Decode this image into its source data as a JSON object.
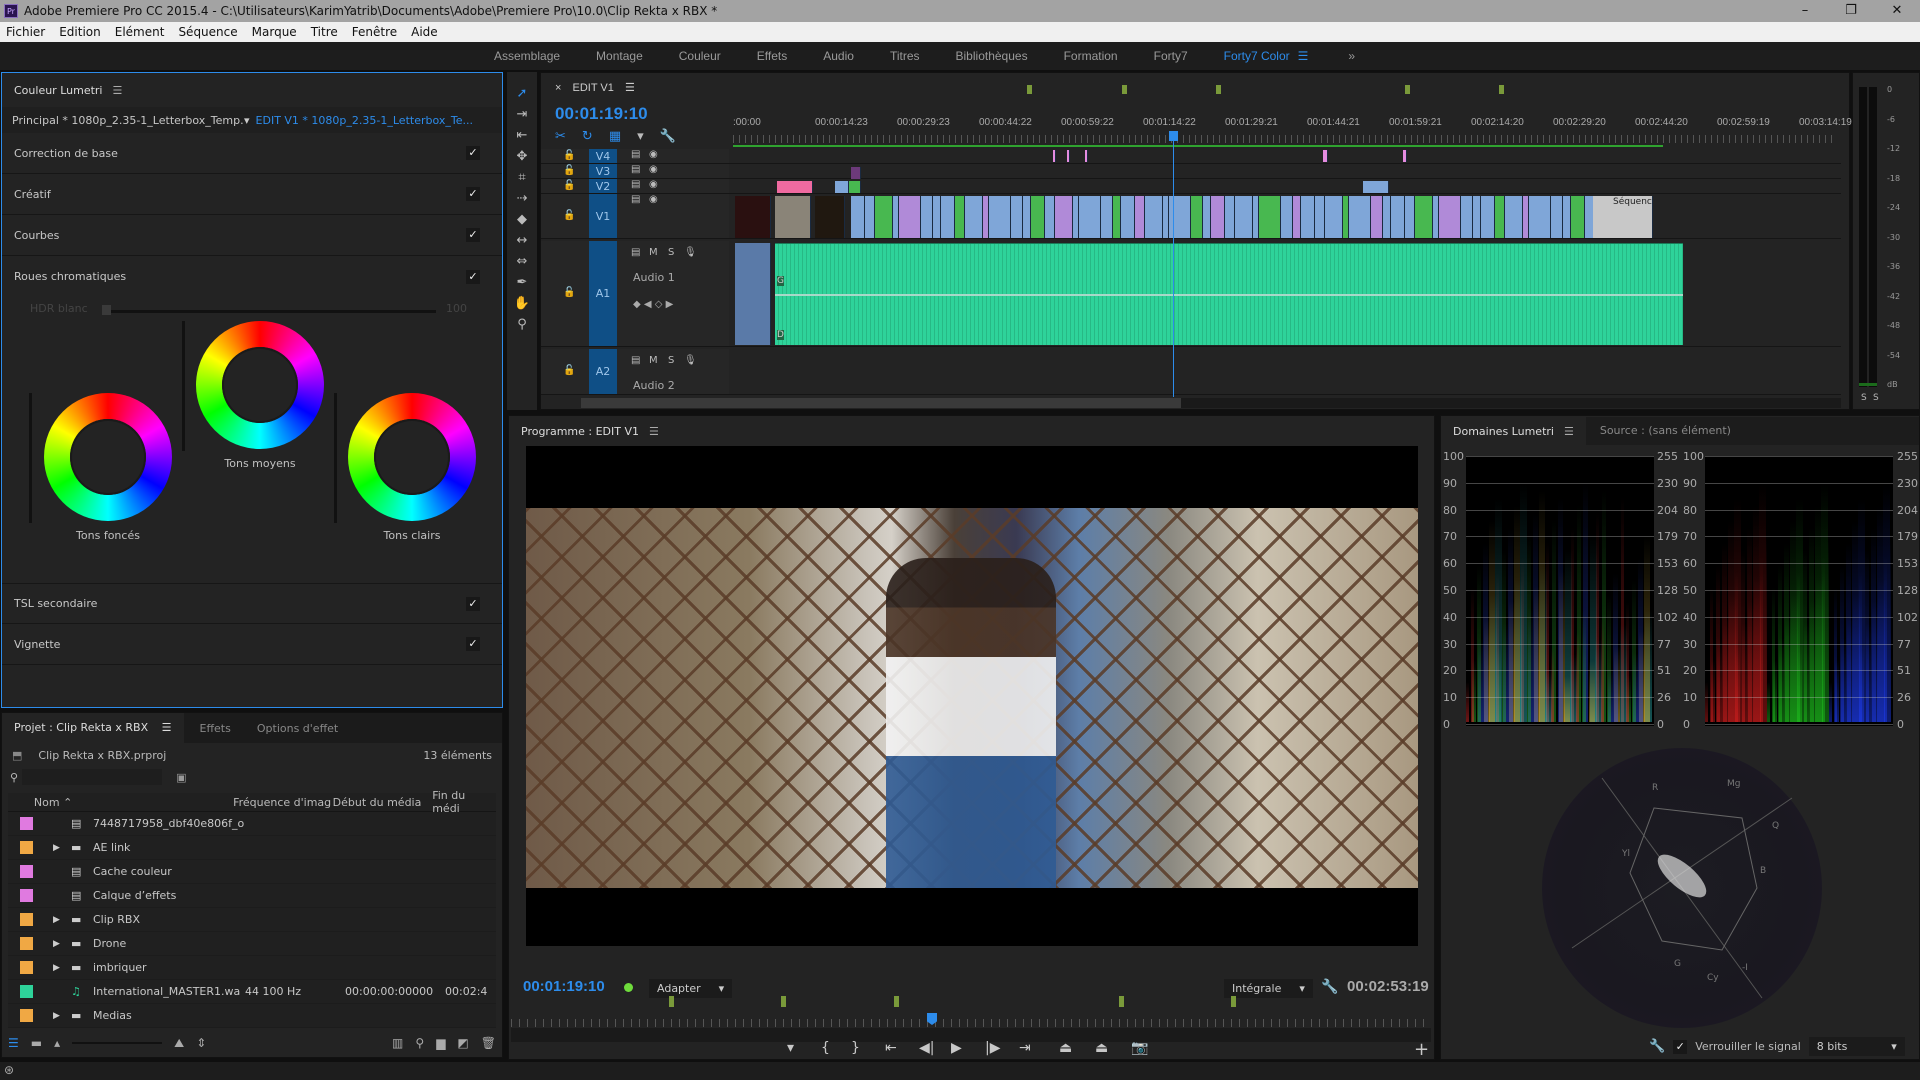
{
  "window": {
    "title": "Adobe Premiere Pro CC 2015.4 - C:\\Utilisateurs\\KarimYatrib\\Documents\\Adobe\\Premiere Pro\\10.0\\Clip Rekta x RBX *",
    "app_icon": "Pr",
    "controls": [
      "–",
      "❐",
      "✕"
    ]
  },
  "menu": [
    "Fichier",
    "Edition",
    "Elément",
    "Séquence",
    "Marque",
    "Titre",
    "Fenêtre",
    "Aide"
  ],
  "workspaces": {
    "items": [
      "Assemblage",
      "Montage",
      "Couleur",
      "Effets",
      "Audio",
      "Titres",
      "Bibliothèques",
      "Formation",
      "Forty7",
      "Forty7 Color"
    ],
    "active": "Forty7 Color",
    "more": "»"
  },
  "lumetri": {
    "title": "Couleur Lumetri",
    "source_master": "Principal * 1080p_2.35-1_Letterbox_Temp...",
    "source_clip": "EDIT V1 * 1080p_2.35-1_Letterbox_Te...",
    "sections": [
      {
        "label": "Correction de base",
        "enabled": true
      },
      {
        "label": "Créatif",
        "enabled": true
      },
      {
        "label": "Courbes",
        "enabled": true
      },
      {
        "label": "Roues chromatiques",
        "enabled": true
      }
    ],
    "hdr_label": "HDR blanc",
    "hdr_value": "100",
    "wheels": {
      "shadows": "Tons foncés",
      "midtones": "Tons moyens",
      "highlights": "Tons clairs"
    },
    "bottom_sections": [
      {
        "label": "TSL secondaire",
        "enabled": true
      },
      {
        "label": "Vignette",
        "enabled": true
      }
    ]
  },
  "project": {
    "tabs": [
      "Projet : Clip Rekta x RBX",
      "Effets",
      "Options d'effet"
    ],
    "file": "Clip Rekta x RBX.prproj",
    "count": "13 éléments",
    "search_placeholder": "",
    "columns": [
      "Nom",
      "Fréquence d'imag",
      "Début du média",
      "Fin du médi"
    ],
    "rows": [
      {
        "color": "#e07ae0",
        "type": "file",
        "name": "7448717958_dbf40e806f_o",
        "fps": "",
        "start": "",
        "end": ""
      },
      {
        "color": "#f0a844",
        "type": "folder",
        "name": "AE link",
        "fps": "",
        "start": "",
        "end": ""
      },
      {
        "color": "#e07ae0",
        "type": "file",
        "name": "Cache couleur",
        "fps": "",
        "start": "",
        "end": ""
      },
      {
        "color": "#e07ae0",
        "type": "file",
        "name": "Calque d’effets",
        "fps": "",
        "start": "",
        "end": ""
      },
      {
        "color": "#f0a844",
        "type": "folder",
        "name": "Clip RBX",
        "fps": "",
        "start": "",
        "end": ""
      },
      {
        "color": "#f0a844",
        "type": "folder",
        "name": "Drone",
        "fps": "",
        "start": "",
        "end": ""
      },
      {
        "color": "#f0a844",
        "type": "folder",
        "name": "imbriquer",
        "fps": "",
        "start": "",
        "end": ""
      },
      {
        "color": "#2ed39a",
        "type": "audio",
        "name": "International_MASTER1.wa",
        "fps": "44 100  Hz",
        "start": "00:00:00:00000",
        "end": "00:02:4"
      },
      {
        "color": "#f0a844",
        "type": "folder",
        "name": "Medias",
        "fps": "",
        "start": "",
        "end": ""
      }
    ]
  },
  "timeline": {
    "tab": "EDIT V1",
    "timecode": "00:01:19:10",
    "ruler": [
      ":00:00",
      "00:00:14:23",
      "00:00:29:23",
      "00:00:44:22",
      "00:00:59:22",
      "00:01:14:22",
      "00:01:29:21",
      "00:01:44:21",
      "00:01:59:21",
      "00:02:14:20",
      "00:02:29:20",
      "00:02:44:20",
      "00:02:59:19",
      "00:03:14:19"
    ],
    "playhead_fraction": 0.396,
    "tracks": {
      "v4": "V4",
      "v3": "V3",
      "v2": "V2",
      "v1": "V1",
      "a1": "A1",
      "a1_name": "Audio 1",
      "a2": "A2",
      "a2_name": "Audio 2",
      "mute": "M",
      "solo": "S"
    },
    "clip_label": "Séquenc",
    "audio_channels": [
      "G",
      "D"
    ]
  },
  "meters": {
    "scale": [
      "0",
      "-6",
      "-12",
      "-18",
      "-24",
      "-30",
      "-36",
      "-42",
      "-48",
      "-54",
      "dB"
    ],
    "solo": [
      "S",
      "S"
    ]
  },
  "program": {
    "title": "Programme : EDIT V1",
    "timecode": "00:01:19:10",
    "zoom": "Adapter",
    "quality": "Intégrale",
    "duration": "00:02:53:19",
    "add": "+",
    "buttons": [
      "marker",
      "mark-in",
      "mark-out",
      "go-to-in",
      "step-back",
      "play",
      "step-forward",
      "go-to-out",
      "lift",
      "extract",
      "export-frame"
    ]
  },
  "scopes": {
    "tab": "Domaines Lumetri",
    "source_tab": "Source : (sans élément)",
    "ire": [
      "100",
      "90",
      "80",
      "70",
      "60",
      "50",
      "40",
      "30",
      "20",
      "10",
      "0"
    ],
    "bits": [
      "255",
      "230",
      "204",
      "179",
      "153",
      "128",
      "102",
      "77",
      "51",
      "26",
      "0"
    ],
    "vector_labels": [
      "R",
      "Mg",
      "B",
      "Cy",
      "G",
      "Yl",
      "Q",
      "-I"
    ],
    "lock_label": "Verrouiller le signal",
    "lock_checked": true,
    "depth": "8 bits"
  },
  "colors": {
    "accent": "#2d8ceb",
    "audio": "#2ed39a",
    "track": "#0f4f86"
  }
}
